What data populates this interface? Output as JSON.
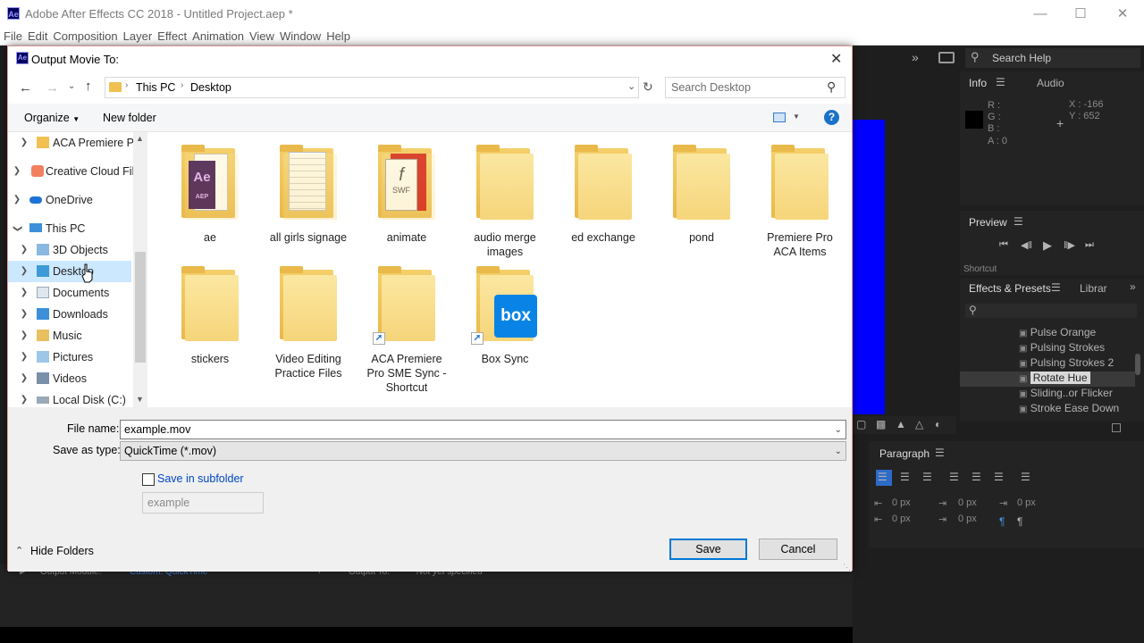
{
  "app": {
    "logo": "Ae",
    "title": "Adobe After Effects CC 2018 - Untitled Project.aep *",
    "menu": [
      "File",
      "Edit",
      "Composition",
      "Layer",
      "Effect",
      "Animation",
      "View",
      "Window",
      "Help"
    ]
  },
  "panels": {
    "search_help": "Search Help",
    "info": {
      "tab": "Info",
      "tab2": "Audio",
      "r": "R :",
      "g": "G :",
      "b": "B :",
      "a": "A : 0",
      "x": "X : -166",
      "y": "Y : 652"
    },
    "preview": {
      "title": "Preview",
      "shortcut": "Shortcut"
    },
    "effects": {
      "tab": "Effects & Presets",
      "tab2": "Librar",
      "items": [
        "Pulse Orange",
        "Pulsing Strokes",
        "Pulsing Strokes 2",
        "Rotate Hue",
        "Sliding..or Flicker",
        "Stroke Ease Down"
      ],
      "selected": "Rotate Hue"
    },
    "paragraph": {
      "title": "Paragraph",
      "indent_left": "0 px",
      "indent_right": "0 px",
      "indent_first": "0 px",
      "space_before": "0 px",
      "space_after": "0 px"
    },
    "render_queue": {
      "output_module_label": "Output Module:",
      "output_module_value": "Custom: QuickTime",
      "output_to_label": "Output To:",
      "output_to_value": "Not yet specified"
    }
  },
  "dialog": {
    "title": "Output Movie To:",
    "breadcrumb": [
      "This PC",
      "Desktop"
    ],
    "search_placeholder": "Search Desktop",
    "organize": "Organize",
    "new_folder": "New folder",
    "tree": [
      {
        "label": "ACA Premiere Pr",
        "expanded": false
      },
      {
        "label": "Creative Cloud File",
        "expanded": false
      },
      {
        "label": "OneDrive",
        "expanded": false
      },
      {
        "label": "This PC",
        "expanded": true
      },
      {
        "label": "3D Objects",
        "expanded": false
      },
      {
        "label": "Desktop",
        "expanded": false,
        "selected": true
      },
      {
        "label": "Documents",
        "expanded": false
      },
      {
        "label": "Downloads",
        "expanded": false
      },
      {
        "label": "Music",
        "expanded": false
      },
      {
        "label": "Pictures",
        "expanded": false
      },
      {
        "label": "Videos",
        "expanded": false
      },
      {
        "label": "Local Disk (C:)",
        "expanded": false
      }
    ],
    "folders": [
      {
        "name": "ae",
        "badge": "AEP"
      },
      {
        "name": "all girls signage"
      },
      {
        "name": "animate",
        "badge": "SWF"
      },
      {
        "name": "audio merge images"
      },
      {
        "name": "ed exchange"
      },
      {
        "name": "pond"
      },
      {
        "name": "Premiere Pro ACA Items"
      },
      {
        "name": "stickers"
      },
      {
        "name": "Video Editing Practice Files"
      },
      {
        "name": "ACA Premiere Pro SME Sync - Shortcut",
        "shortcut": true
      },
      {
        "name": "Box Sync",
        "shortcut": true,
        "badge": "box"
      }
    ],
    "file_name_label": "File name:",
    "file_name": "example.mov",
    "save_type_label": "Save as type:",
    "save_type": "QuickTime (*.mov)",
    "subfolder_label": "Save in subfolder",
    "subfolder_placeholder": "example",
    "hide_folders": "Hide Folders",
    "save": "Save",
    "cancel": "Cancel"
  }
}
